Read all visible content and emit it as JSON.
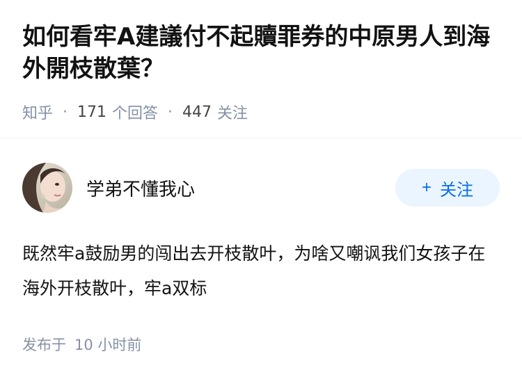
{
  "question": {
    "title": "如何看牢A建議付不起贖罪券的中原男人到海外開枝散葉？",
    "source": "知乎",
    "answer_count": "171",
    "answer_label": "个回答",
    "follower_count": "447",
    "follower_label": "关注"
  },
  "answer": {
    "author_name": "学弟不懂我心",
    "follow_button": {
      "icon": "+",
      "label": "关注"
    },
    "content": "既然牢a鼓励男的闯出去开枝散叶，为啥又嘲讽我们女孩子在海外开枝散叶，牢a双标",
    "published_label": "发布于",
    "published_time": "10 小时前"
  },
  "colors": {
    "accent": "#056de8",
    "follow_bg": "#ebf5ff",
    "meta_gray": "#8590a6",
    "text": "#121212"
  }
}
